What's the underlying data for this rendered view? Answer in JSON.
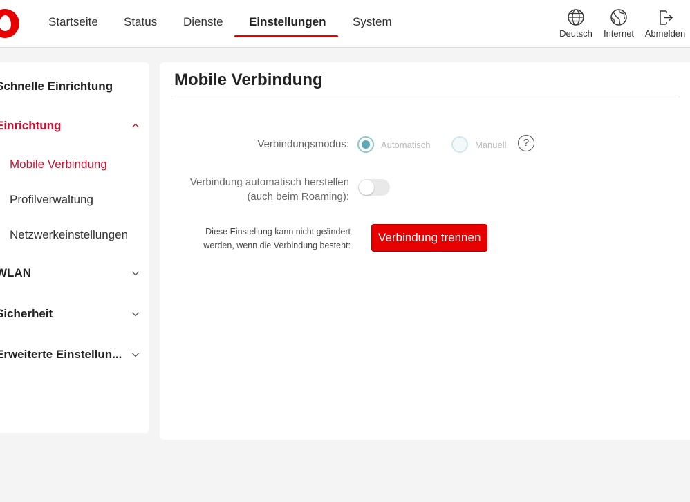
{
  "nav": {
    "items": [
      "Startseite",
      "Status",
      "Dienste",
      "Einstellungen",
      "System"
    ],
    "active": "Einstellungen"
  },
  "tools": {
    "language": {
      "label": "Deutsch",
      "icon": "globe-icon"
    },
    "internet": {
      "label": "Internet",
      "icon": "internet-globe-icon"
    },
    "logout": {
      "label": "Abmelden",
      "icon": "logout-icon"
    }
  },
  "sidebar": {
    "quick_setup": "Schnelle Einrichtung",
    "setup": "Einrichtung",
    "setup_children": [
      "Mobile Verbindung",
      "Profilverwaltung",
      "Netzwerkeinstellungen"
    ],
    "wlan": "WLAN",
    "security": "Sicherheit",
    "advanced": "Erweiterte Einstellun..."
  },
  "main": {
    "title": "Mobile Verbindung",
    "mode_label": "Verbindungsmodus:",
    "mode_options": [
      "Automatisch",
      "Manuell"
    ],
    "mode_selected": "Automatisch",
    "auto_connect_label_1": "Verbindung automatisch herstellen",
    "auto_connect_label_2": "(auch beim Roaming):",
    "auto_connect_on": false,
    "note_line_1": "Diese Einstellung kann nicht geändert",
    "note_line_2": "werden, wenn die Verbindung besteht:",
    "disconnect_button": "Verbindung trennen",
    "help_symbol": "?"
  },
  "colors": {
    "brand_red": "#e60000",
    "active_text_red": "#c8102e",
    "radio_teal": "#5aa9b8"
  }
}
